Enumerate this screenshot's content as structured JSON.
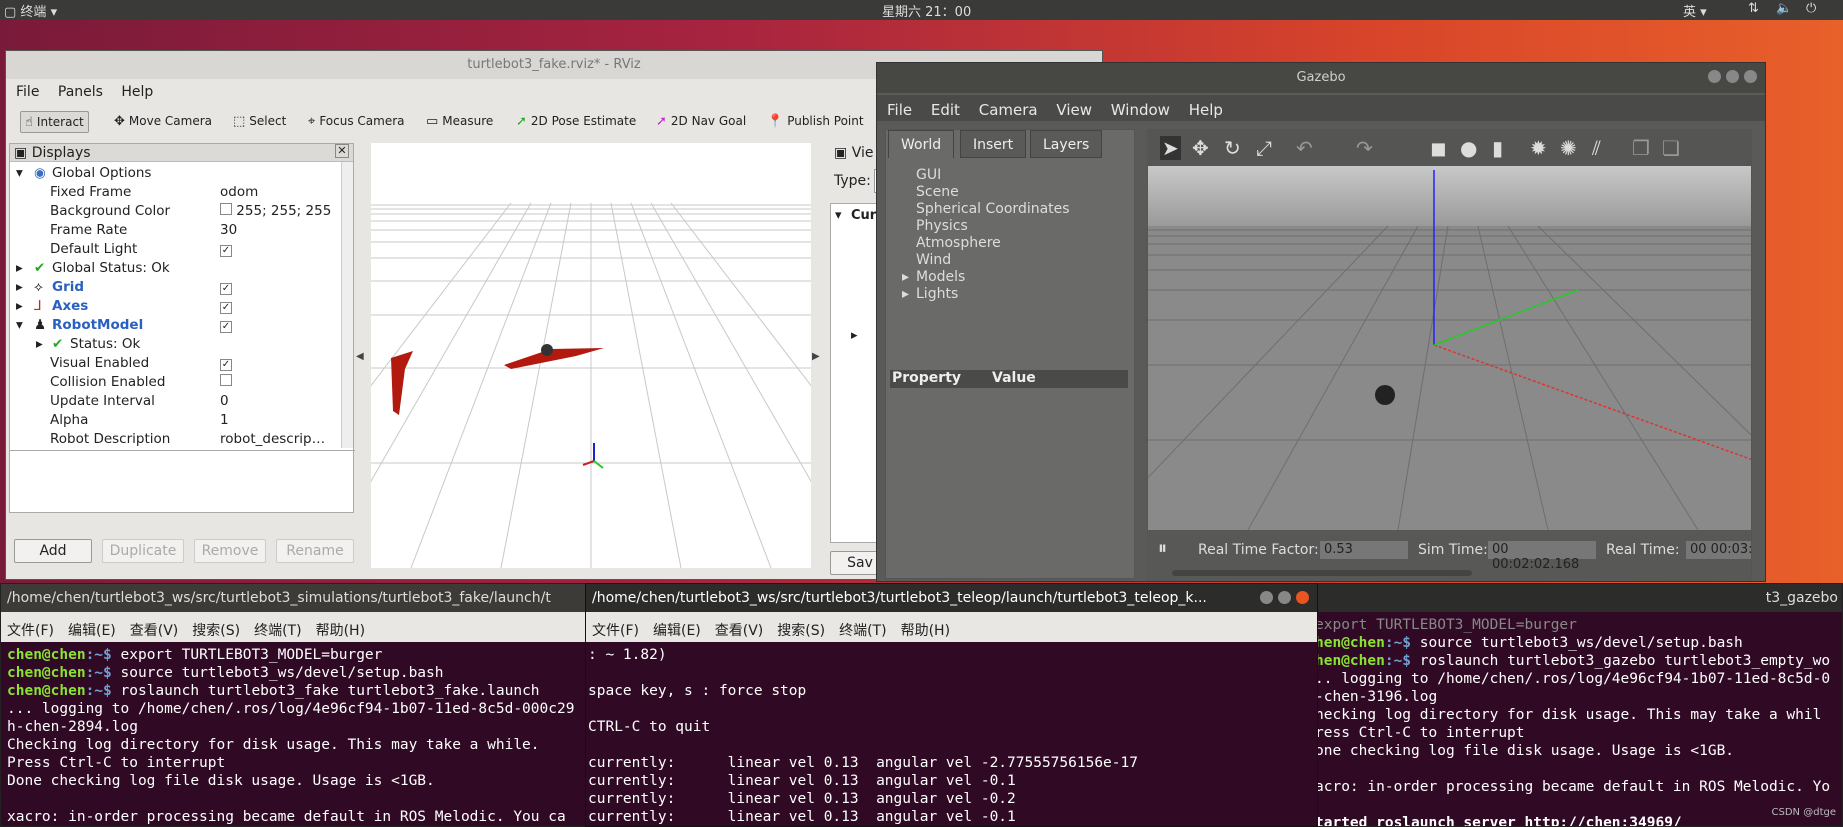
{
  "topbar": {
    "app_menu": "终端",
    "clock": "星期六 21：00",
    "input_method": "英"
  },
  "rviz": {
    "title": "turtlebot3_fake.rviz* - RViz",
    "menu": [
      "File",
      "Panels",
      "Help"
    ],
    "tools": [
      "Interact",
      "Move Camera",
      "Select",
      "Focus Camera",
      "Measure",
      "2D Pose Estimate",
      "2D Nav Goal",
      "Publish Point"
    ],
    "displays_title": "Displays",
    "tree": [
      {
        "k": "Global Options",
        "v": ""
      },
      {
        "k": "Fixed Frame",
        "v": "odom"
      },
      {
        "k": "Background Color",
        "v": "255; 255; 255"
      },
      {
        "k": "Frame Rate",
        "v": "30"
      },
      {
        "k": "Default Light",
        "v": "✓"
      },
      {
        "k": "Global Status: Ok",
        "v": ""
      },
      {
        "k": "Grid",
        "v": "✓"
      },
      {
        "k": "Axes",
        "v": "✓"
      },
      {
        "k": "RobotModel",
        "v": "✓"
      },
      {
        "k": "Status: Ok",
        "v": ""
      },
      {
        "k": "Visual Enabled",
        "v": "✓"
      },
      {
        "k": "Collision Enabled",
        "v": ""
      },
      {
        "k": "Update Interval",
        "v": "0"
      },
      {
        "k": "Alpha",
        "v": "1"
      },
      {
        "k": "Robot Description",
        "v": "robot_descrip…"
      }
    ],
    "buttons": [
      "Add",
      "Duplicate",
      "Remove",
      "Rename"
    ],
    "views_title": "Vie",
    "type_label": "Type:",
    "cur_label": "Cur",
    "save_label": "Sav"
  },
  "gazebo": {
    "title": "Gazebo",
    "menu": [
      "File",
      "Edit",
      "Camera",
      "View",
      "Window",
      "Help"
    ],
    "tabs": [
      "World",
      "Insert",
      "Layers"
    ],
    "tree": [
      "GUI",
      "Scene",
      "Spherical Coordinates",
      "Physics",
      "Atmosphere",
      "Wind",
      "Models",
      "Lights"
    ],
    "prop_header": "Property",
    "value_header": "Value",
    "rtf_label": "Real Time Factor:",
    "rtf_value": "0.53",
    "sim_label": "Sim Time:",
    "sim_value": "00 00:02:02.168",
    "real_label": "Real Time:",
    "real_value": "00 00:03:"
  },
  "term1": {
    "title": "/home/chen/turtlebot3_ws/src/turtlebot3_simulations/turtlebot3_fake/launch/t",
    "menu": [
      "文件(F)",
      "编辑(E)",
      "查看(V)",
      "搜索(S)",
      "终端(T)",
      "帮助(H)"
    ],
    "prompt": "chen@chen",
    "lines": [
      {
        "p": ":~$ ",
        "t": "export TURTLEBOT3_MODEL=burger"
      },
      {
        "p": ":~$ ",
        "t": "source turtlebot3_ws/devel/setup.bash"
      },
      {
        "p": ":~$ ",
        "t": "roslaunch turtlebot3_fake turtlebot3_fake.launch"
      }
    ],
    "out": [
      "... logging to /home/chen/.ros/log/4e96cf94-1b07-11ed-8c5d-000c29",
      "h-chen-2894.log",
      "Checking log directory for disk usage. This may take a while.",
      "Press Ctrl-C to interrupt",
      "Done checking log file disk usage. Usage is <1GB.",
      "",
      "xacro: in-order processing became default in ROS Melodic. You ca"
    ]
  },
  "term2": {
    "title": "/home/chen/turtlebot3_ws/src/turtlebot3/turtlebot3_teleop/launch/turtlebot3_teleop_k...",
    "menu": [
      "文件(F)",
      "编辑(E)",
      "查看(V)",
      "搜索(S)",
      "终端(T)",
      "帮助(H)"
    ],
    "out": [
      ": ~ 1.82)",
      "",
      "space key, s : force stop",
      "",
      "CTRL-C to quit",
      "",
      "currently:      linear vel 0.13  angular vel -2.77555756156e-17",
      "currently:      linear vel 0.13  angular vel -0.1",
      "currently:      linear vel 0.13  angular vel -0.2",
      "currently:      linear vel 0.13  angular vel -0.1"
    ]
  },
  "term3": {
    "title": "t3_gazebo",
    "prompt": "hen@chen",
    "lines": [
      {
        "p": ":~$ ",
        "t": "export TURTLEBOT3_MODEL=burger"
      },
      {
        "p": ":~$ ",
        "t": "source turtlebot3_ws/devel/setup.bash"
      },
      {
        "p": ":~$ ",
        "t": "roslaunch turtlebot3_gazebo turtlebot3_empty_wo"
      }
    ],
    "out": [
      ".. logging to /home/chen/.ros/log/4e96cf94-1b07-11ed-8c5d-0",
      "-chen-3196.log",
      "hecking log directory for disk usage. This may take a whil",
      "ress Ctrl-C to interrupt",
      "one checking log file disk usage. Usage is <1GB.",
      "",
      "acro: in-order processing became default in ROS Melodic. Yo",
      "",
      "tarted roslaunch server http://chen:34969/"
    ],
    "watermark": "CSDN @dtge"
  }
}
